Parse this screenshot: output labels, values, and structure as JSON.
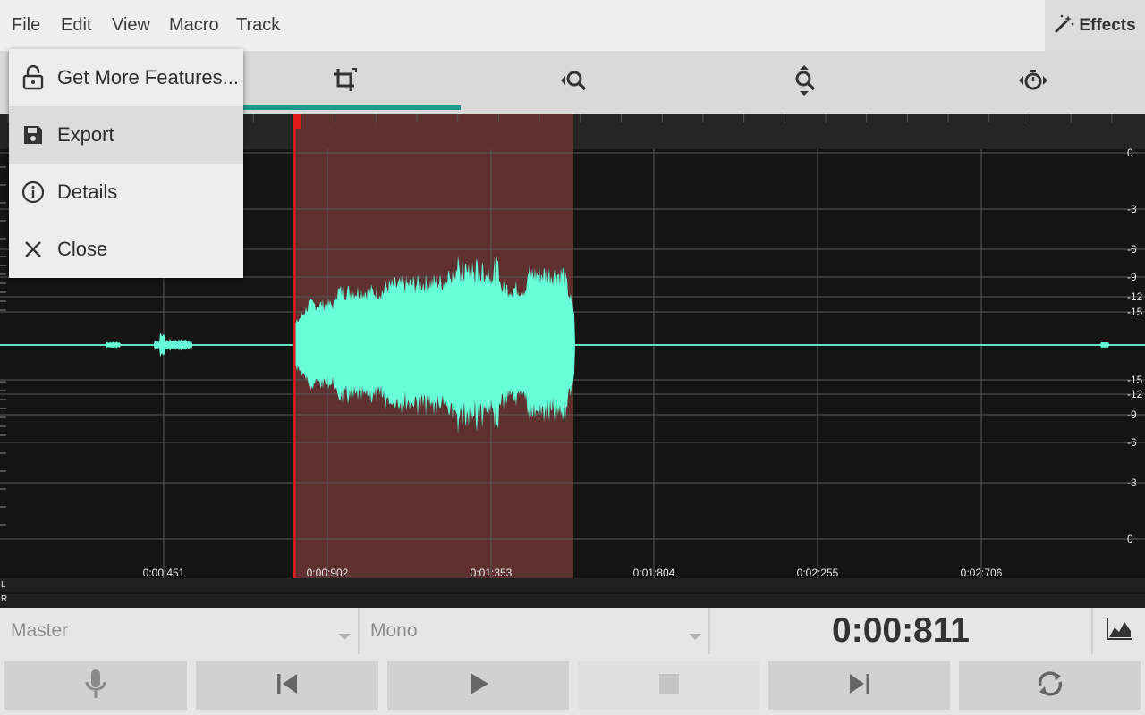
{
  "menubar": {
    "items": [
      "File",
      "Edit",
      "View",
      "Macro",
      "Track"
    ],
    "effects_label": "Effects"
  },
  "toolbar": {
    "tools": [
      "select-tool",
      "crop-tool",
      "zoom-horizontal-tool",
      "zoom-vertical-tool",
      "timer-tool"
    ],
    "active_index": 1
  },
  "file_menu": {
    "items": [
      {
        "label": "Get More Features...",
        "icon": "unlock-icon"
      },
      {
        "label": "Export",
        "icon": "save-icon"
      },
      {
        "label": "Details",
        "icon": "info-icon"
      },
      {
        "label": "Close",
        "icon": "close-icon"
      }
    ],
    "highlighted_index": 1
  },
  "waveform": {
    "time_labels": [
      "0:00:451",
      "0:00:902",
      "0:01:353",
      "0:01:804",
      "0:02:255",
      "0:02:706"
    ],
    "db_labels": [
      "0",
      "-3",
      "-6",
      "-9",
      "-12",
      "-15",
      "-15",
      "-12",
      "-9",
      "-6",
      "-3",
      "0"
    ],
    "channel_labels": [
      "L",
      "R"
    ],
    "selection_start": "0:00:811",
    "selection_end": "0:01:612",
    "colors": {
      "waveform": "#66ffd8",
      "selection": "#5e3030",
      "cursor": "#e01a1a",
      "background": "#141414"
    }
  },
  "controls": {
    "track_select": "Master",
    "channel_select": "Mono",
    "time": "0:00:811"
  },
  "transport": {
    "buttons": [
      "record",
      "skip-back",
      "play",
      "stop",
      "skip-forward",
      "loop"
    ],
    "stop_enabled": false
  },
  "accent_color": "#1a9a8a"
}
